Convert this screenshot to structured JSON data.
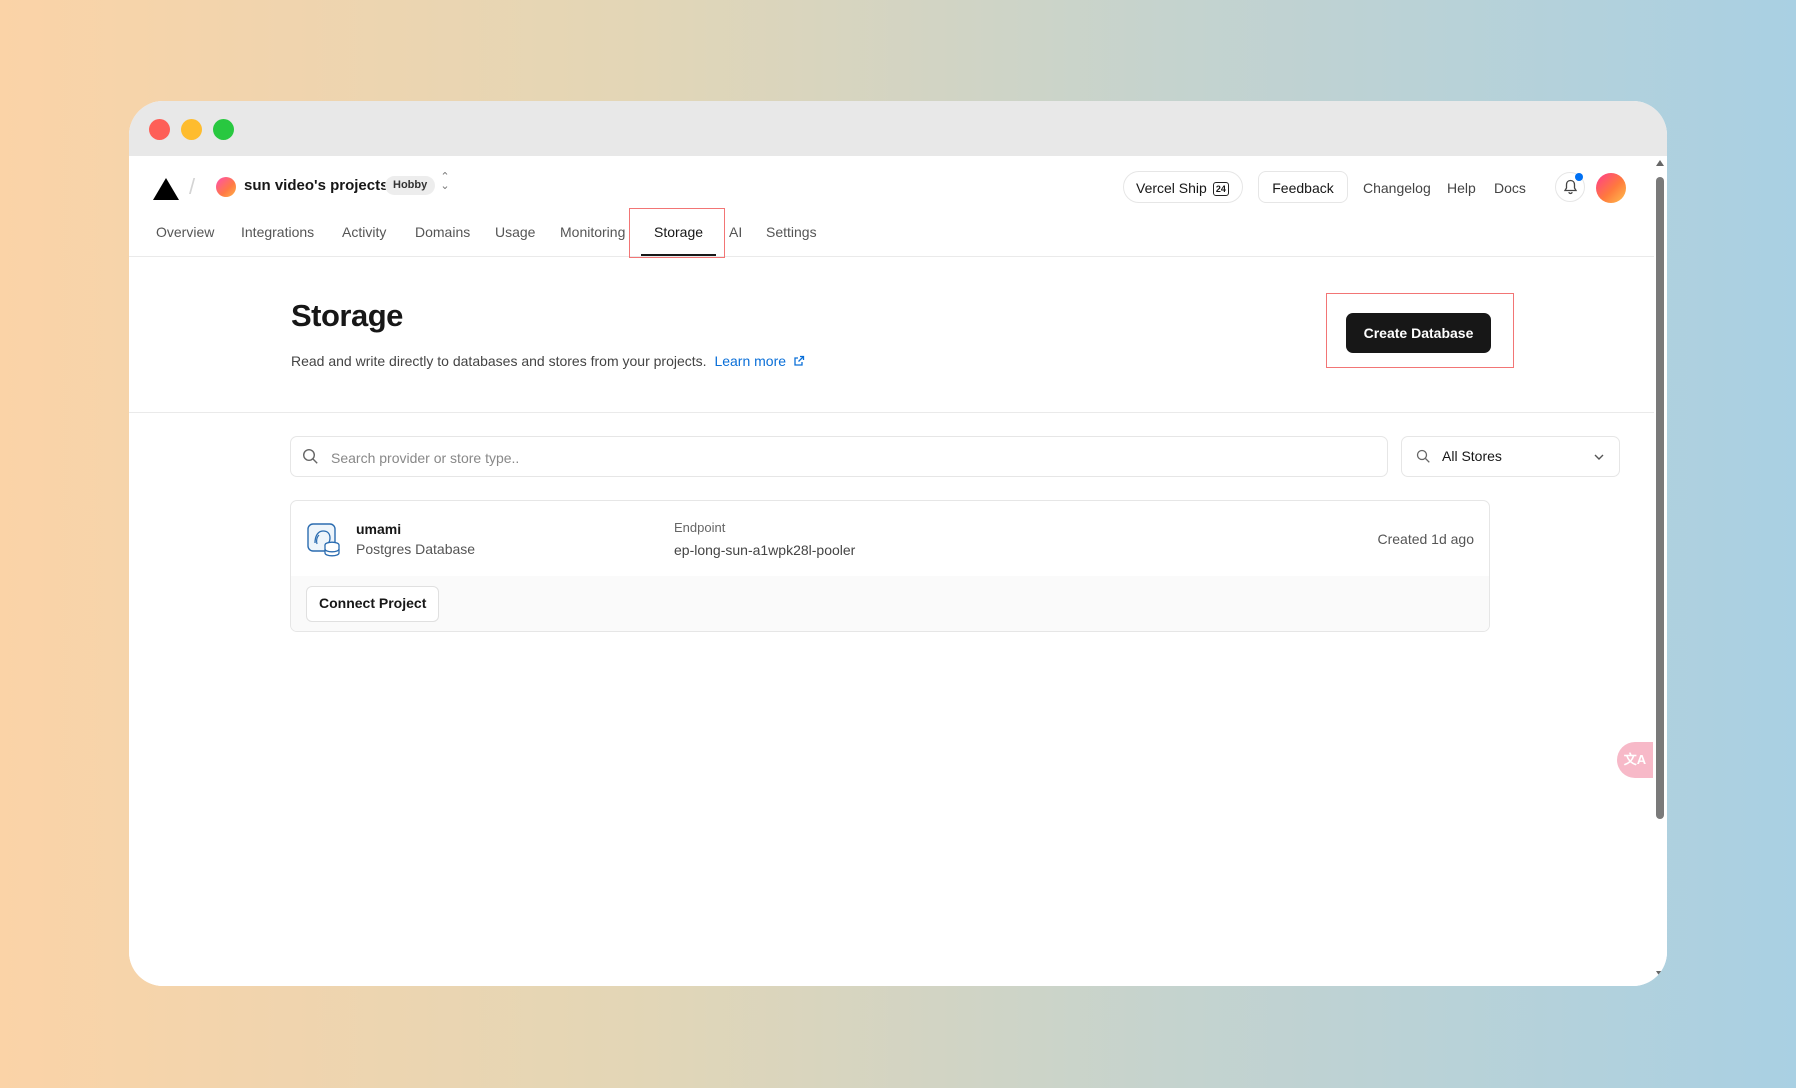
{
  "window": {
    "controls": [
      "close",
      "minimize",
      "maximize"
    ]
  },
  "header": {
    "team_name": "sun video's projects",
    "plan_badge": "Hobby",
    "ship_label": "Vercel Ship",
    "ship_badge": "24",
    "feedback_label": "Feedback",
    "links": [
      "Changelog",
      "Help",
      "Docs"
    ],
    "icons": [
      "vercel-logo-icon",
      "switcher-chevrons-icon",
      "bell-icon",
      "user-avatar"
    ]
  },
  "tabs": [
    {
      "label": "Overview"
    },
    {
      "label": "Integrations"
    },
    {
      "label": "Activity"
    },
    {
      "label": "Domains"
    },
    {
      "label": "Usage"
    },
    {
      "label": "Monitoring"
    },
    {
      "label": "Storage",
      "active": true
    },
    {
      "label": "AI"
    },
    {
      "label": "Settings"
    }
  ],
  "hero": {
    "title": "Storage",
    "subtitle": "Read and write directly to databases and stores from your projects.",
    "learn_more": "Learn more",
    "create_button": "Create Database"
  },
  "filters": {
    "search_placeholder": "Search provider or store type..",
    "store_filter_value": "All Stores"
  },
  "stores": [
    {
      "name": "umami",
      "type": "Postgres Database",
      "endpoint_label": "Endpoint",
      "endpoint": "ep-long-sun-a1wpk28l-pooler",
      "created": "Created 1d ago",
      "connect_button": "Connect Project"
    }
  ],
  "colors": {
    "accent": "#0a6fd8",
    "primary_button": "#171717",
    "highlight_box": "#f27575"
  }
}
